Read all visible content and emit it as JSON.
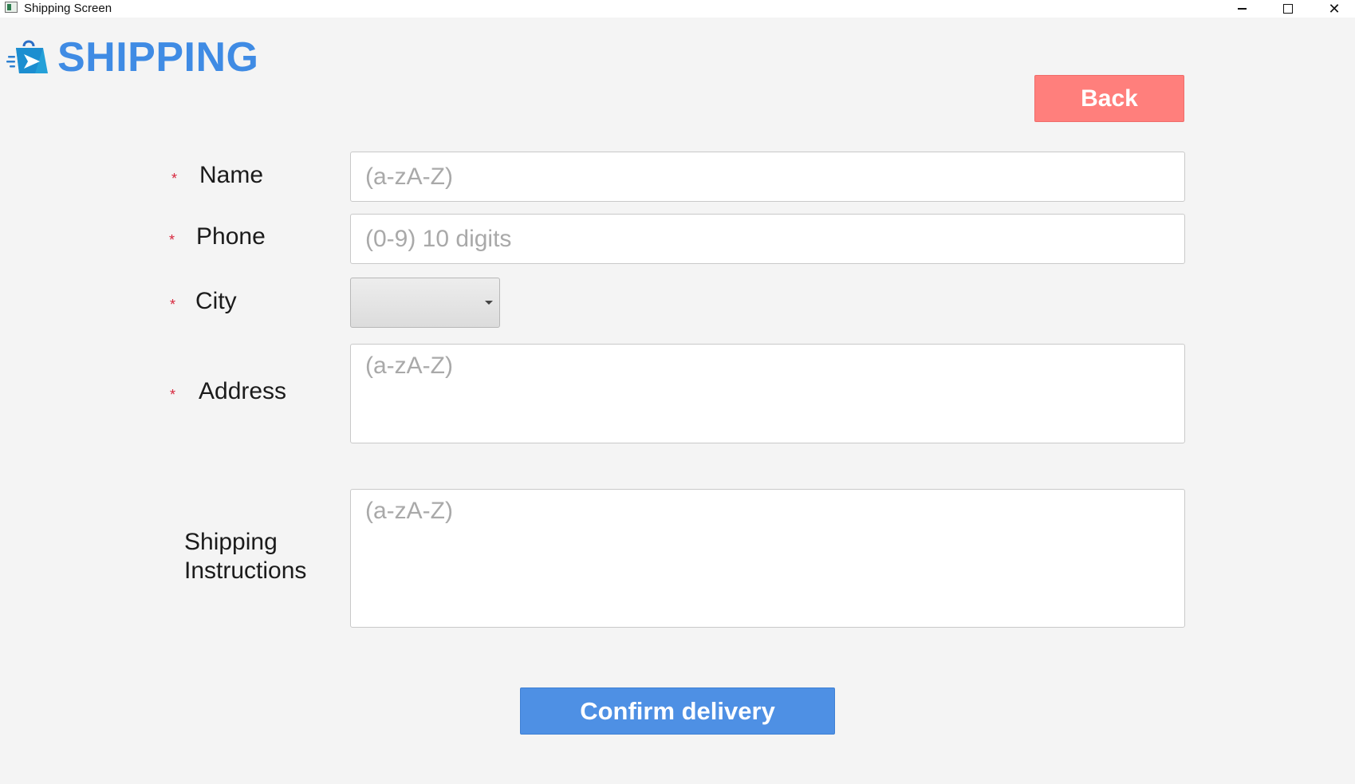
{
  "window": {
    "title": "Shipping Screen",
    "controls": {
      "minimize": "minimize-icon",
      "maximize": "maximize-icon",
      "close": "close-icon"
    }
  },
  "header": {
    "logo_text": "SHIPPING",
    "logo_icon": "shopping-bag-icon"
  },
  "actions": {
    "back_label": "Back",
    "confirm_label": "Confirm delivery"
  },
  "form": {
    "required_mark": "*",
    "name": {
      "label": "Name",
      "placeholder": "(a-zA-Z)",
      "value": ""
    },
    "phone": {
      "label": "Phone",
      "placeholder": "(0-9) 10 digits",
      "value": ""
    },
    "city": {
      "label": "City",
      "selected": ""
    },
    "address": {
      "label": "Address",
      "placeholder": "(a-zA-Z)",
      "value": ""
    },
    "instructions": {
      "label_line1": "Shipping",
      "label_line2": "Instructions",
      "placeholder": "(a-zA-Z)",
      "value": ""
    }
  },
  "colors": {
    "brand_blue": "#3f8be4",
    "back_button": "#ff7f7c",
    "confirm_button": "#4e90e4",
    "required_red": "#d7263d",
    "background": "#f4f4f4"
  }
}
